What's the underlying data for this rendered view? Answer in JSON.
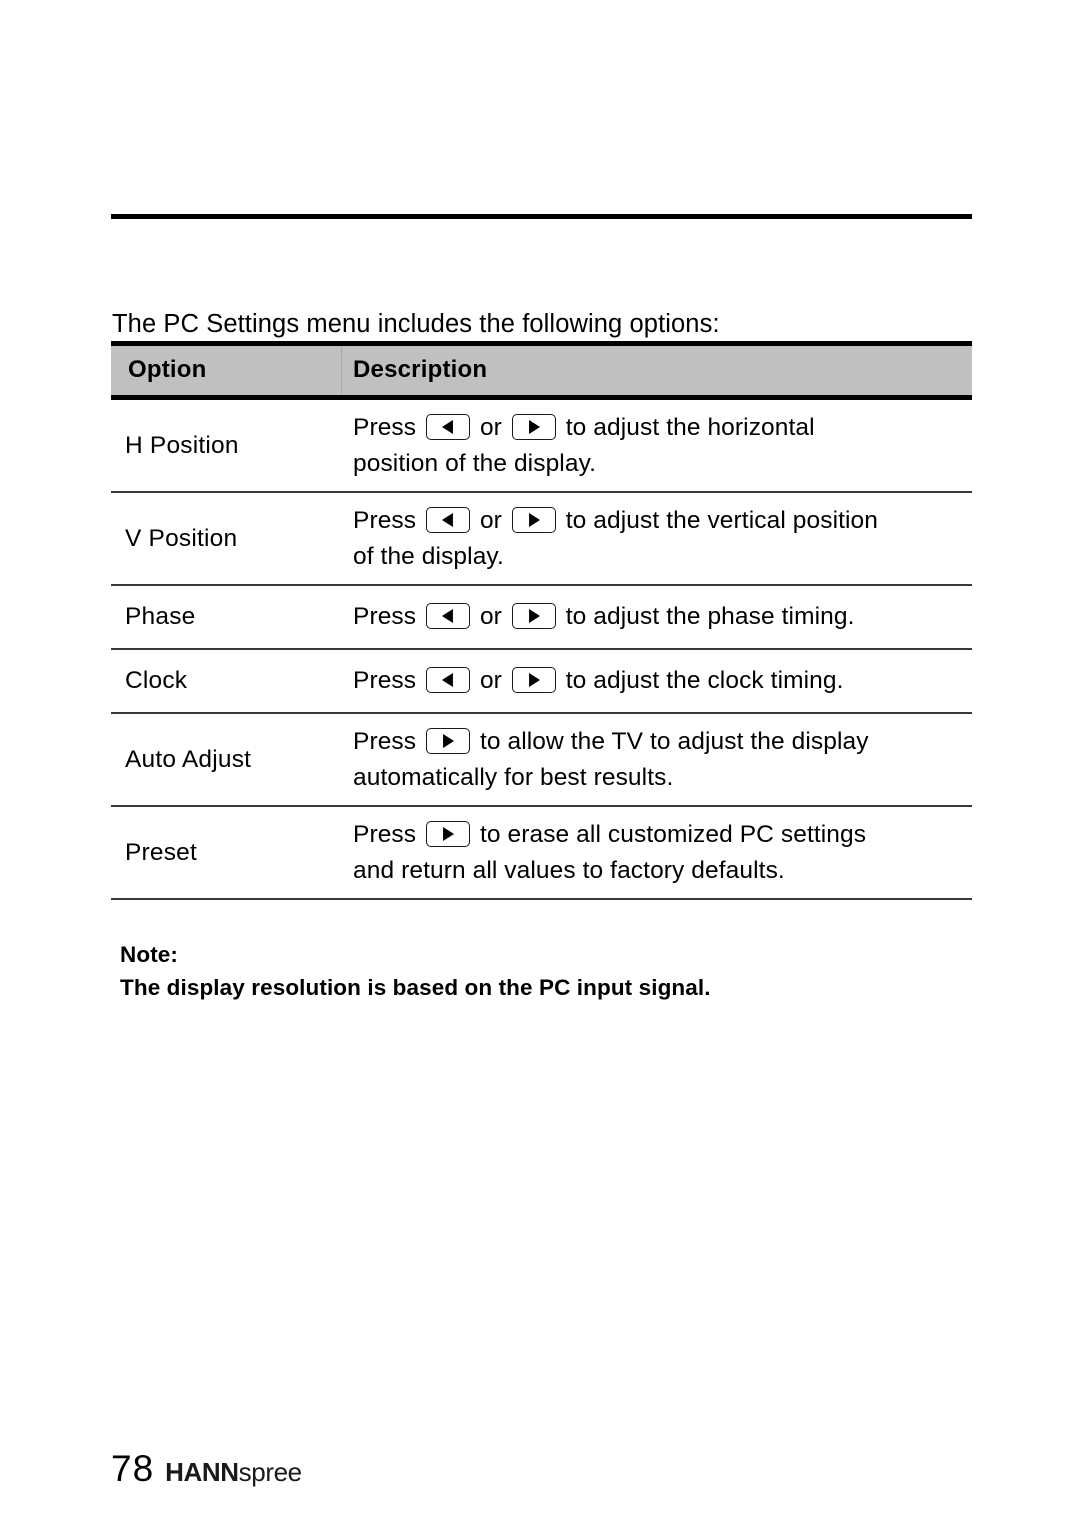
{
  "intro": {
    "text": "The PC Settings menu includes the following options:"
  },
  "table": {
    "headers": {
      "option": "Option",
      "description": "Description"
    },
    "rows": [
      {
        "option": "H Position",
        "size": "tall",
        "lines": [
          {
            "segments": [
              {
                "type": "text",
                "text": "Press "
              },
              {
                "type": "key",
                "icon": "arrow-left-button"
              },
              {
                "type": "text",
                "text": " or "
              },
              {
                "type": "key",
                "icon": "arrow-right-button"
              },
              {
                "type": "text",
                "text": " to adjust the horizontal"
              }
            ]
          },
          {
            "segments": [
              {
                "type": "text",
                "text": "position of the display."
              }
            ]
          }
        ]
      },
      {
        "option": "V Position",
        "size": "tall",
        "lines": [
          {
            "segments": [
              {
                "type": "text",
                "text": "Press "
              },
              {
                "type": "key",
                "icon": "arrow-left-button"
              },
              {
                "type": "text",
                "text": " or "
              },
              {
                "type": "key",
                "icon": "arrow-right-button"
              },
              {
                "type": "text",
                "text": " to adjust the vertical position"
              }
            ]
          },
          {
            "segments": [
              {
                "type": "text",
                "text": "of the display."
              }
            ]
          }
        ]
      },
      {
        "option": "Phase",
        "size": "short",
        "lines": [
          {
            "segments": [
              {
                "type": "text",
                "text": "Press "
              },
              {
                "type": "key",
                "icon": "arrow-left-button"
              },
              {
                "type": "text",
                "text": " or "
              },
              {
                "type": "key",
                "icon": "arrow-right-button"
              },
              {
                "type": "text",
                "text": " to adjust the phase timing."
              }
            ]
          }
        ]
      },
      {
        "option": "Clock",
        "size": "short",
        "lines": [
          {
            "segments": [
              {
                "type": "text",
                "text": "Press "
              },
              {
                "type": "key",
                "icon": "arrow-left-button"
              },
              {
                "type": "text",
                "text": " or "
              },
              {
                "type": "key",
                "icon": "arrow-right-button"
              },
              {
                "type": "text",
                "text": " to adjust the clock timing."
              }
            ]
          }
        ]
      },
      {
        "option": "Auto Adjust",
        "size": "tall",
        "lines": [
          {
            "segments": [
              {
                "type": "text",
                "text": "Press "
              },
              {
                "type": "key",
                "icon": "arrow-right-button"
              },
              {
                "type": "text",
                "text": " to allow the TV to adjust the display"
              }
            ]
          },
          {
            "segments": [
              {
                "type": "text",
                "text": "automatically for best results."
              }
            ]
          }
        ]
      },
      {
        "option": "Preset",
        "size": "tall",
        "lines": [
          {
            "segments": [
              {
                "type": "text",
                "text": "Press "
              },
              {
                "type": "key",
                "icon": "arrow-right-button"
              },
              {
                "type": "text",
                "text": " to erase all customized PC settings"
              }
            ]
          },
          {
            "segments": [
              {
                "type": "text",
                "text": "and return all values to factory defaults."
              }
            ]
          }
        ]
      }
    ]
  },
  "note": {
    "label": "Note:",
    "body": "The display resolution is based on the PC input signal."
  },
  "footer": {
    "page_number": "78",
    "brand_bold": "HANN",
    "brand_light": "spree"
  },
  "colors": {
    "header_background": "#c0c0c0",
    "rule": "#000000",
    "row_separator": "#3a3a3a",
    "text": "#000000"
  }
}
